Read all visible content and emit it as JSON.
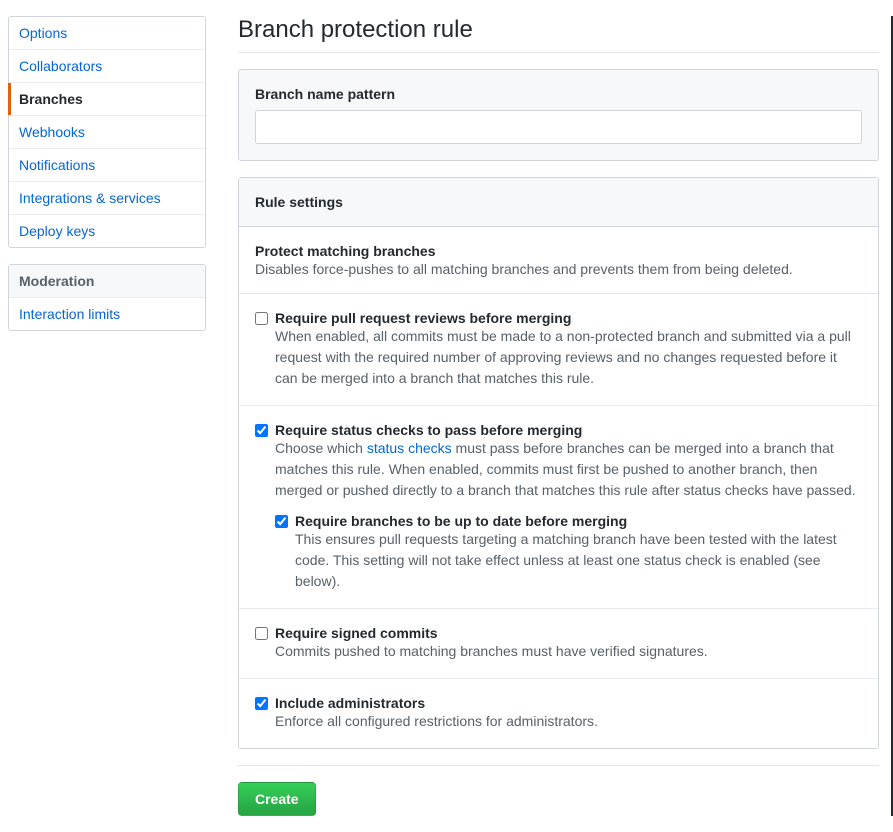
{
  "sidebar": {
    "menu1": [
      {
        "label": "Options"
      },
      {
        "label": "Collaborators"
      },
      {
        "label": "Branches",
        "selected": true
      },
      {
        "label": "Webhooks"
      },
      {
        "label": "Notifications"
      },
      {
        "label": "Integrations & services"
      },
      {
        "label": "Deploy keys"
      }
    ],
    "menu2_heading": "Moderation",
    "menu2": [
      {
        "label": "Interaction limits"
      }
    ]
  },
  "page": {
    "title": "Branch protection rule",
    "pattern_label": "Branch name pattern",
    "pattern_value": "",
    "rule_settings_heading": "Rule settings",
    "protect_heading": "Protect matching branches",
    "protect_desc": "Disables force-pushes to all matching branches and prevents them from being deleted.",
    "rules": {
      "pr_reviews": {
        "checked": false,
        "title": "Require pull request reviews before merging",
        "desc": "When enabled, all commits must be made to a non-protected branch and submitted via a pull request with the required number of approving reviews and no changes requested before it can be merged into a branch that matches this rule."
      },
      "status_checks": {
        "checked": true,
        "title": "Require status checks to pass before merging",
        "desc_pre": "Choose which ",
        "desc_link": "status checks",
        "desc_post": " must pass before branches can be merged into a branch that matches this rule. When enabled, commits must first be pushed to another branch, then merged or pushed directly to a branch that matches this rule after status checks have passed.",
        "nested": {
          "checked": true,
          "title": "Require branches to be up to date before merging",
          "desc": "This ensures pull requests targeting a matching branch have been tested with the latest code. This setting will not take effect unless at least one status check is enabled (see below)."
        }
      },
      "signed_commits": {
        "checked": false,
        "title": "Require signed commits",
        "desc": "Commits pushed to matching branches must have verified signatures."
      },
      "include_admins": {
        "checked": true,
        "title": "Include administrators",
        "desc": "Enforce all configured restrictions for administrators."
      }
    },
    "create_button": "Create"
  }
}
